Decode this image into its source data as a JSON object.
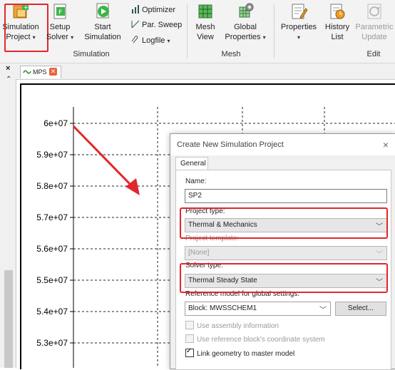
{
  "ribbon": {
    "simulation_project": {
      "line1": "Simulation",
      "line2": "Project"
    },
    "setup_solver": {
      "line1": "Setup",
      "line2": "Solver"
    },
    "start_simulation": {
      "line1": "Start",
      "line2": "Simulation"
    },
    "optimizer": "Optimizer",
    "par_sweep": "Par. Sweep",
    "logfile": "Logfile",
    "group_simulation": "Simulation",
    "mesh_view": {
      "line1": "Mesh",
      "line2": "View"
    },
    "global_properties": {
      "line1": "Global",
      "line2": "Properties"
    },
    "group_mesh": "Mesh",
    "properties": "Properties",
    "history_list": {
      "line1": "History",
      "line2": "List"
    },
    "parametric_update": {
      "line1": "Parametric",
      "line2": "Update"
    },
    "group_edit": "Edit"
  },
  "tabs": {
    "close_x": "×",
    "pin": "⌃",
    "doc_tab_label": "MPS"
  },
  "plot": {
    "y_ticks": [
      "6e+07",
      "5.9e+07",
      "5.8e+07",
      "5.7e+07",
      "5.6e+07",
      "5.5e+07",
      "5.4e+07",
      "5.3e+07"
    ],
    "y_values": [
      60000000,
      59000000,
      58000000,
      57000000,
      56000000,
      55000000,
      54000000,
      53000000
    ]
  },
  "dialog": {
    "title": "Create New Simulation Project",
    "close": "×",
    "tab_general": "General",
    "name_label": "Name:",
    "name_value": "SP2",
    "project_type_label": "Project type:",
    "project_type_value": "Thermal & Mechanics",
    "project_template_label": "Project template:",
    "project_template_value": "[None]",
    "solver_type_label": "Solver type:",
    "solver_type_value": "Thermal Steady State",
    "reference_model_label": "Reference model for global settings:",
    "reference_model_value": "Block: MWSSCHEM1",
    "select_button": "Select...",
    "use_assembly": "Use assembly information",
    "use_reference_cs": "Use reference block's coordinate system",
    "link_geometry": "Link geometry to master model"
  },
  "colors": {
    "highlight": "#e3262b",
    "arrow": "#e3262b"
  }
}
